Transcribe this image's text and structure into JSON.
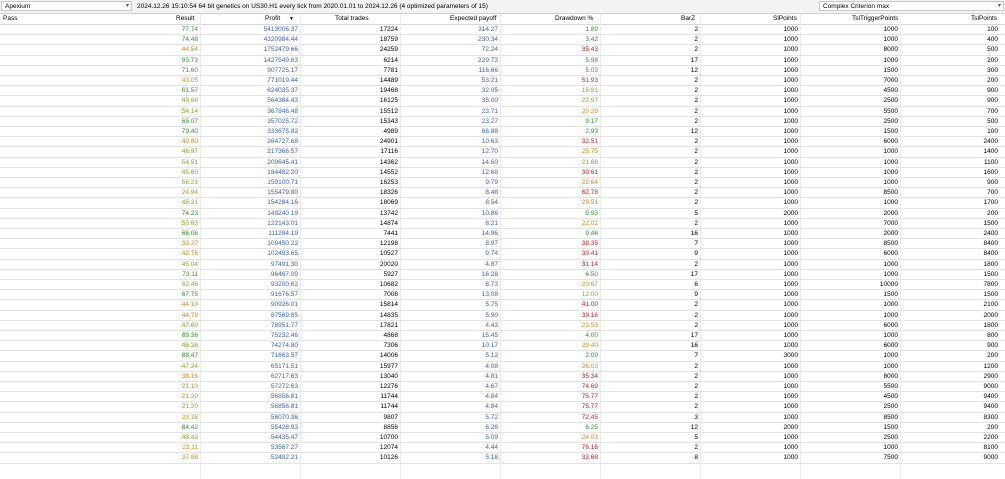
{
  "toolbar": {
    "expert": "Apexium",
    "info": "2024.12.26 15:10:54   64 bit genetics  on US30.H1 every tick  from 2020.01.01 to 2024.12.26  (4 optimized parameters of 15)",
    "criterion": "Complex Criterion max"
  },
  "columns": [
    "Pass",
    "Result",
    "Profit",
    "Total trades",
    "Expected payoff",
    "Drawdown %",
    "BarZ",
    "SlPoints",
    "TslTriggerPoints",
    "TslPoints"
  ],
  "sort_indicator": "▼",
  "colors": {
    "green": "#2e9b2e",
    "olive": "#8aaa22",
    "orange": "#d98a1a",
    "red": "#cc2222",
    "blue": "#3a63c6"
  },
  "rows": [
    [
      "",
      "77.74",
      "5413006.37",
      "17224",
      "314.27",
      "1.89",
      "2",
      "1000",
      "1000",
      "100"
    ],
    [
      "",
      "74.48",
      "4320984.44",
      "18759",
      "230.34",
      "3.42",
      "2",
      "1000",
      "1000",
      "400"
    ],
    [
      "",
      "44.54",
      "1752479.66",
      "24259",
      "72.24",
      "35.43",
      "2",
      "1000",
      "8000",
      "500"
    ],
    [
      "",
      "93.73",
      "1427549.63",
      "6214",
      "229.73",
      "5.98",
      "17",
      "1000",
      "1000",
      "200"
    ],
    [
      "",
      "71.60",
      "907725.17",
      "7781",
      "116.66",
      "5.03",
      "12",
      "1000",
      "1500",
      "300"
    ],
    [
      "",
      "43.05",
      "771019.44",
      "14489",
      "53.21",
      "51.93",
      "2",
      "1000",
      "7000",
      "200"
    ],
    [
      "",
      "61.57",
      "624035.37",
      "19468",
      "32.05",
      "15.81",
      "2",
      "1000",
      "4500",
      "900"
    ],
    [
      "",
      "49.66",
      "564384.43",
      "16125",
      "35.00",
      "22.97",
      "2",
      "1000",
      "2500",
      "900"
    ],
    [
      "",
      "54.14",
      "367846.48",
      "15512",
      "23.71",
      "20.29",
      "2",
      "1000",
      "5500",
      "700"
    ],
    [
      "",
      "65.07",
      "357025.72",
      "15343",
      "23.27",
      "9.17",
      "2",
      "1000",
      "2500",
      "500"
    ],
    [
      "",
      "79.40",
      "333675.82",
      "4989",
      "66.88",
      "2.93",
      "12",
      "1000",
      "1500",
      "100"
    ],
    [
      "",
      "40.80",
      "264727.68",
      "24901",
      "10.63",
      "32.51",
      "2",
      "1000",
      "6000",
      "2400"
    ],
    [
      "",
      "46.97",
      "217366.57",
      "17116",
      "12.70",
      "25.75",
      "2",
      "1000",
      "1000",
      "1400"
    ],
    [
      "",
      "54.51",
      "209645.41",
      "14362",
      "14.60",
      "21.68",
      "2",
      "1000",
      "1000",
      "1100"
    ],
    [
      "",
      "45.60",
      "184482.20",
      "14552",
      "12.68",
      "30.61",
      "2",
      "1000",
      "1000",
      "1600"
    ],
    [
      "",
      "56.21",
      "159100.71",
      "16253",
      "9.79",
      "22.64",
      "2",
      "1000",
      "1000",
      "900"
    ],
    [
      "",
      "24.94",
      "155479.80",
      "18326",
      "8.48",
      "62.78",
      "2",
      "1000",
      "8500",
      "700"
    ],
    [
      "",
      "45.31",
      "154284.16",
      "18069",
      "8.54",
      "29.51",
      "2",
      "1000",
      "1000",
      "1700"
    ],
    [
      "",
      "74.23",
      "149240.19",
      "13742",
      "10.86",
      "9.93",
      "5",
      "2000",
      "2000",
      "200"
    ],
    [
      "",
      "50.63",
      "122143.01",
      "14874",
      "8.21",
      "22.02",
      "2",
      "1000",
      "7000",
      "1500"
    ],
    [
      "",
      "66.06",
      "111284.19",
      "7441",
      "14.96",
      "9.46",
      "16",
      "1000",
      "2000",
      "2400"
    ],
    [
      "",
      "33.27",
      "109450.22",
      "12198",
      "8.97",
      "38.35",
      "7",
      "1000",
      "8500",
      "8400"
    ],
    [
      "",
      "42.76",
      "102493.65",
      "10527",
      "9.74",
      "30.41",
      "9",
      "1000",
      "6000",
      "8400"
    ],
    [
      "",
      "45.04",
      "97491.30",
      "20020",
      "4.87",
      "31.14",
      "2",
      "1000",
      "1000",
      "1800"
    ],
    [
      "",
      "73.11",
      "96467.09",
      "5927",
      "16.28",
      "6.50",
      "17",
      "1000",
      "1000",
      "1500"
    ],
    [
      "",
      "52.46",
      "93200.62",
      "10682",
      "8.73",
      "20.67",
      "6",
      "1000",
      "10000",
      "7800"
    ],
    [
      "",
      "67.75",
      "91676.57",
      "7008",
      "13.08",
      "12.00",
      "9",
      "1000",
      "1500",
      "1500"
    ],
    [
      "",
      "44.10",
      "90926.01",
      "15814",
      "5.75",
      "41.00",
      "2",
      "1000",
      "1000",
      "2100"
    ],
    [
      "",
      "44.79",
      "87569.85",
      "14835",
      "5.90",
      "39.16",
      "2",
      "1000",
      "1000",
      "2000"
    ],
    [
      "",
      "47.60",
      "78951.77",
      "17821",
      "4.43",
      "23.53",
      "2",
      "1000",
      "6000",
      "1800"
    ],
    [
      "",
      "89.36",
      "75232.46",
      "4868",
      "15.45",
      "4.00",
      "17",
      "1000",
      "1000",
      "800"
    ],
    [
      "",
      "46.28",
      "74274.80",
      "7306",
      "10.17",
      "29.40",
      "16",
      "1000",
      "6000",
      "900"
    ],
    [
      "",
      "88.47",
      "71663.57",
      "14006",
      "5.12",
      "2.09",
      "7",
      "3000",
      "1000",
      "200"
    ],
    [
      "",
      "47.24",
      "65171.51",
      "15977",
      "4.08",
      "26.03",
      "2",
      "1000",
      "1000",
      "1200"
    ],
    [
      "",
      "38.16",
      "62717.63",
      "13040",
      "4.81",
      "35.34",
      "2",
      "1000",
      "8000",
      "2900"
    ],
    [
      "",
      "21.10",
      "57272.63",
      "12276",
      "4.67",
      "74.69",
      "2",
      "1000",
      "5500",
      "9000"
    ],
    [
      "",
      "21.20",
      "56856.81",
      "11744",
      "4.84",
      "75.77",
      "2",
      "1000",
      "4500",
      "9400"
    ],
    [
      "",
      "21.20",
      "56856.81",
      "11744",
      "4.84",
      "75.77",
      "2",
      "1000",
      "2500",
      "9400"
    ],
    [
      "",
      "23.78",
      "56070.36",
      "9807",
      "5.72",
      "72.45",
      "3",
      "1000",
      "8500",
      "8300"
    ],
    [
      "",
      "84.42",
      "55428.93",
      "8856",
      "6.26",
      "6.25",
      "12",
      "2000",
      "1500",
      "200"
    ],
    [
      "",
      "48.42",
      "54435.47",
      "10700",
      "5.09",
      "24.03",
      "5",
      "1000",
      "2500",
      "2200"
    ],
    [
      "",
      "22.11",
      "53567.27",
      "12074",
      "4.44",
      "76.16",
      "2",
      "1000",
      "1000",
      "8100"
    ],
    [
      "",
      "37.98",
      "52492.21",
      "10126",
      "5.18",
      "33.68",
      "8",
      "1000",
      "7500",
      "9000"
    ]
  ]
}
